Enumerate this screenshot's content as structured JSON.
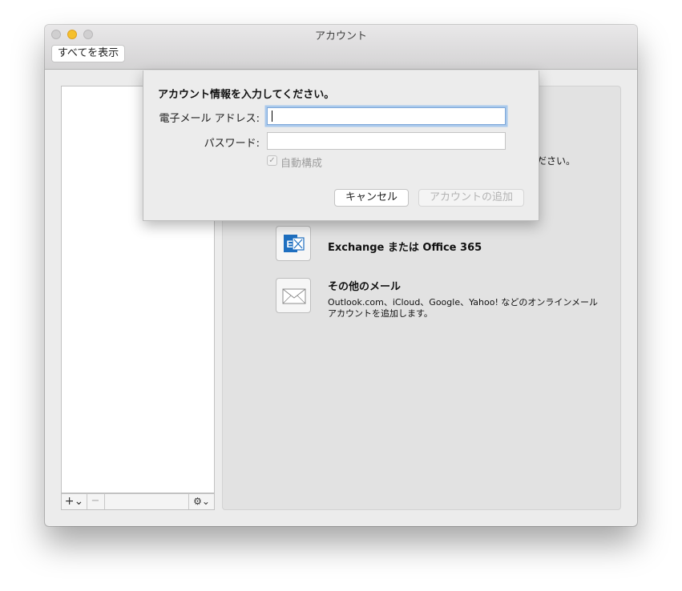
{
  "window": {
    "title": "アカウント",
    "show_all_button": "すべてを表示"
  },
  "account_list": {
    "add_symbol": "+⌄",
    "remove_symbol": "−",
    "gear_symbol": "⚙⌄"
  },
  "main": {
    "partially_hidden_text": "ださい。",
    "account_types": [
      {
        "icon": "exchange-icon",
        "title": "Exchange または Office 365",
        "description": ""
      },
      {
        "icon": "envelope-icon",
        "title": "その他のメール",
        "description": "Outlook.com、iCloud、Google、Yahoo! などのオンラインメール アカウントを追加します。"
      }
    ]
  },
  "dialog": {
    "title": "アカウント情報を入力してください。",
    "email_label": "電子メール アドレス:",
    "email_value": "",
    "password_label": "パスワード:",
    "password_value": "",
    "auto_config_label": "自動構成",
    "auto_config_checked": true,
    "cancel_button": "キャンセル",
    "add_account_button": "アカウントの追加"
  },
  "colors": {
    "exchange_blue": "#1e6fc0",
    "focus_ring": "#a9c9ec",
    "minimize_yellow": "#f5c02c"
  }
}
